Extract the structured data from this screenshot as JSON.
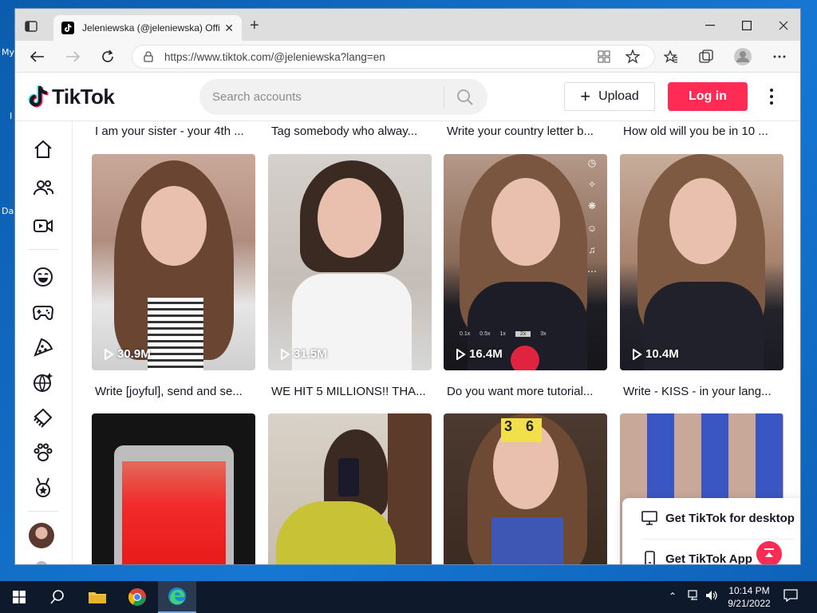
{
  "desktop": {
    "icon_labels": [
      "My",
      "I",
      "Da"
    ]
  },
  "browser": {
    "tab_title": "Jeleniewska (@jeleniewska) Offic",
    "url": "https://www.tiktok.com/@jeleniewska?lang=en"
  },
  "header": {
    "logo_text": "TikTok",
    "search_placeholder": "Search accounts",
    "upload_label": "Upload",
    "login_label": "Log in"
  },
  "sidebar": {
    "icons": [
      "home-icon",
      "following-icon",
      "live-icon",
      "comedy-icon",
      "gaming-icon",
      "food-icon",
      "travel-icon",
      "beauty-icon",
      "animals-icon",
      "sports-icon"
    ]
  },
  "videos_top_captions": [
    "I am your sister - your 4th ...",
    "Tag somebody who alway...",
    "Write your country letter b...",
    "How old will you be in 10 ..."
  ],
  "videos": [
    {
      "views": "30.9M",
      "caption": "Write [joyful], send and se..."
    },
    {
      "views": "31.5M",
      "caption": "WE HIT 5 MILLIONS!! THA..."
    },
    {
      "views": "16.4M",
      "caption": "Do you want more tutorial..."
    },
    {
      "views": "10.4M",
      "caption": "Write - KISS - in your lang..."
    }
  ],
  "video_overlay": {
    "speeds": [
      "0.1x",
      "0.5x",
      "1x",
      "2x",
      "3x"
    ],
    "sticker_text": "3 6"
  },
  "popup": {
    "desktop_label": "Get TikTok for desktop",
    "app_label": "Get TikTok App"
  },
  "taskbar": {
    "time": "10:14 PM",
    "date": "9/21/2022"
  },
  "colors": {
    "brand": "#fe2c55",
    "text": "#161823"
  }
}
